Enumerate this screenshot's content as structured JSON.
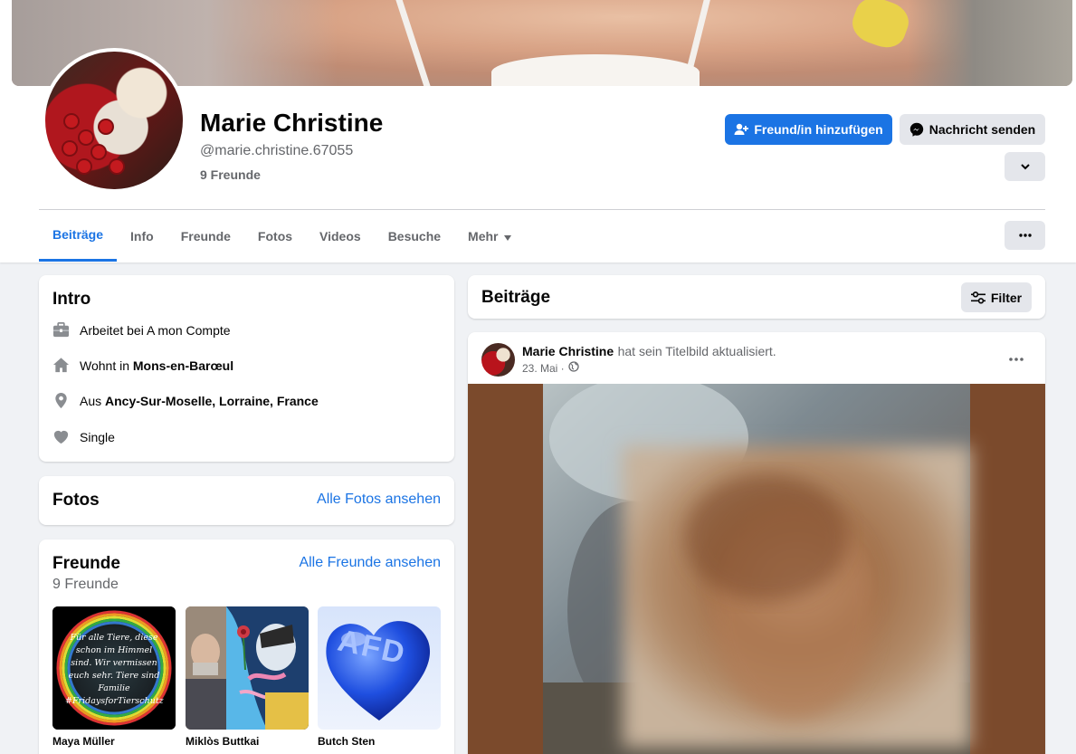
{
  "profile": {
    "name": "Marie Christine",
    "handle": "@marie.christine.67055",
    "friends_count": "9 Freunde"
  },
  "actions": {
    "add_friend": "Freund/in hinzufügen",
    "send_message": "Nachricht senden"
  },
  "tabs": [
    {
      "label": "Beiträge",
      "active": true
    },
    {
      "label": "Info"
    },
    {
      "label": "Freunde"
    },
    {
      "label": "Fotos"
    },
    {
      "label": "Videos"
    },
    {
      "label": "Besuche"
    },
    {
      "label": "Mehr"
    }
  ],
  "intro": {
    "title": "Intro",
    "items": [
      {
        "icon": "briefcase-icon",
        "prefix": "Arbeitet bei A mon Compte",
        "bold": ""
      },
      {
        "icon": "home-icon",
        "prefix": "Wohnt in ",
        "bold": "Mons-en-Barœul"
      },
      {
        "icon": "location-pin-icon",
        "prefix": "Aus ",
        "bold": "Ancy-Sur-Moselle, Lorraine, France"
      },
      {
        "icon": "heart-icon",
        "prefix": "Single",
        "bold": ""
      }
    ]
  },
  "photos": {
    "title": "Fotos",
    "link": "Alle Fotos ansehen"
  },
  "friends": {
    "title": "Freunde",
    "count": "9 Freunde",
    "link": "Alle Freunde ansehen",
    "list": [
      {
        "name": "Maya Müller",
        "image_text": "Für alle Tiere, diese schon im Himmel sind. Wir vermissen euch sehr. Tiere sind Familie #FridaysforTierschutz"
      },
      {
        "name": "Miklòs Buttkai"
      },
      {
        "name": "Butch Sten",
        "image_text": "AFD"
      }
    ]
  },
  "posts_header": {
    "title": "Beiträge",
    "filter": "Filter"
  },
  "post": {
    "author": "Marie Christine",
    "action": "hat sein Titelbild aktualisiert.",
    "date": "23. Mai ·"
  },
  "colors": {
    "primary": "#1b74e4",
    "background": "#f0f2f5",
    "secondary_text": "#65676b"
  }
}
